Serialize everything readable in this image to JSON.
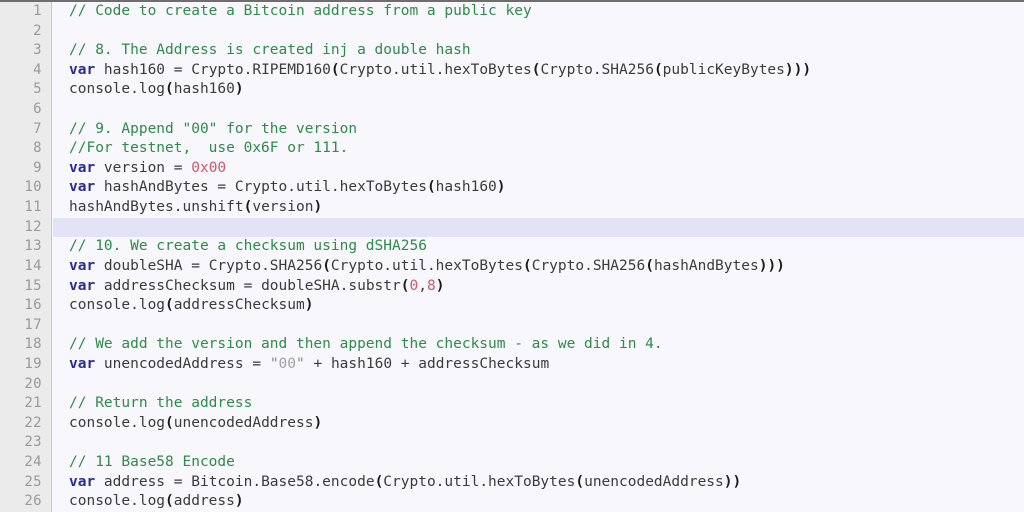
{
  "editor": {
    "name": "code-editor",
    "language": "javascript",
    "first_line": 1,
    "last_line": 26,
    "highlighted_line": 12,
    "colors": {
      "background": "#f7f7fc",
      "gutter_background": "#ebebeb",
      "gutter_divider": "#c8c8c8",
      "line_number": "#9a9a9a",
      "comment": "#2e8b4a",
      "keyword": "#2b2b99",
      "plain_text": "#3b3b3b",
      "bracket": "#1a1a1a",
      "number": "#d1566b",
      "string": "#a0a0a0",
      "highlight_line": "#e3e3f7",
      "top_border": "#6e6e6e"
    }
  },
  "lines": [
    {
      "number": "1",
      "highlight": false,
      "tokens": [
        {
          "type": "com",
          "text": "// Code to create a Bitcoin address from a public key"
        }
      ]
    },
    {
      "number": "2",
      "highlight": false,
      "tokens": []
    },
    {
      "number": "3",
      "highlight": false,
      "tokens": [
        {
          "type": "com",
          "text": "// 8. The Address is created inj a double hash"
        }
      ]
    },
    {
      "number": "4",
      "highlight": false,
      "tokens": [
        {
          "type": "kw",
          "text": "var"
        },
        {
          "type": "txt",
          "text": " hash160 = Crypto.RIPEMD160"
        },
        {
          "type": "par",
          "text": "("
        },
        {
          "type": "txt",
          "text": "Crypto.util.hexToBytes"
        },
        {
          "type": "par",
          "text": "("
        },
        {
          "type": "txt",
          "text": "Crypto.SHA256"
        },
        {
          "type": "par",
          "text": "("
        },
        {
          "type": "txt",
          "text": "publicKeyBytes"
        },
        {
          "type": "par",
          "text": ")))"
        }
      ]
    },
    {
      "number": "5",
      "highlight": false,
      "tokens": [
        {
          "type": "txt",
          "text": "console.log"
        },
        {
          "type": "par",
          "text": "("
        },
        {
          "type": "txt",
          "text": "hash160"
        },
        {
          "type": "par",
          "text": ")"
        }
      ]
    },
    {
      "number": "6",
      "highlight": false,
      "tokens": []
    },
    {
      "number": "7",
      "highlight": false,
      "tokens": [
        {
          "type": "com",
          "text": "// 9. Append \"00\" for the version"
        }
      ]
    },
    {
      "number": "8",
      "highlight": false,
      "tokens": [
        {
          "type": "com",
          "text": "//For testnet,  use 0x6F or 111."
        }
      ]
    },
    {
      "number": "9",
      "highlight": false,
      "tokens": [
        {
          "type": "kw",
          "text": "var"
        },
        {
          "type": "txt",
          "text": " version = "
        },
        {
          "type": "num",
          "text": "0x00"
        }
      ]
    },
    {
      "number": "10",
      "highlight": false,
      "tokens": [
        {
          "type": "kw",
          "text": "var"
        },
        {
          "type": "txt",
          "text": " hashAndBytes = Crypto.util.hexToBytes"
        },
        {
          "type": "par",
          "text": "("
        },
        {
          "type": "txt",
          "text": "hash160"
        },
        {
          "type": "par",
          "text": ")"
        }
      ]
    },
    {
      "number": "11",
      "highlight": false,
      "tokens": [
        {
          "type": "txt",
          "text": "hashAndBytes.unshift"
        },
        {
          "type": "par",
          "text": "("
        },
        {
          "type": "txt",
          "text": "version"
        },
        {
          "type": "par",
          "text": ")"
        }
      ]
    },
    {
      "number": "12",
      "highlight": true,
      "tokens": []
    },
    {
      "number": "13",
      "highlight": false,
      "tokens": [
        {
          "type": "com",
          "text": "// 10. We create a checksum using dSHA256"
        }
      ]
    },
    {
      "number": "14",
      "highlight": false,
      "tokens": [
        {
          "type": "kw",
          "text": "var"
        },
        {
          "type": "txt",
          "text": " doubleSHA = Crypto.SHA256"
        },
        {
          "type": "par",
          "text": "("
        },
        {
          "type": "txt",
          "text": "Crypto.util.hexToBytes"
        },
        {
          "type": "par",
          "text": "("
        },
        {
          "type": "txt",
          "text": "Crypto.SHA256"
        },
        {
          "type": "par",
          "text": "("
        },
        {
          "type": "txt",
          "text": "hashAndBytes"
        },
        {
          "type": "par",
          "text": ")))"
        }
      ]
    },
    {
      "number": "15",
      "highlight": false,
      "tokens": [
        {
          "type": "kw",
          "text": "var"
        },
        {
          "type": "txt",
          "text": " addressChecksum = doubleSHA.substr"
        },
        {
          "type": "par",
          "text": "("
        },
        {
          "type": "num",
          "text": "0"
        },
        {
          "type": "txt",
          "text": ","
        },
        {
          "type": "num",
          "text": "8"
        },
        {
          "type": "par",
          "text": ")"
        }
      ]
    },
    {
      "number": "16",
      "highlight": false,
      "tokens": [
        {
          "type": "txt",
          "text": "console.log"
        },
        {
          "type": "par",
          "text": "("
        },
        {
          "type": "txt",
          "text": "addressChecksum"
        },
        {
          "type": "par",
          "text": ")"
        }
      ]
    },
    {
      "number": "17",
      "highlight": false,
      "tokens": []
    },
    {
      "number": "18",
      "highlight": false,
      "tokens": [
        {
          "type": "com",
          "text": "// We add the version and then append the checksum - as we did in 4."
        }
      ]
    },
    {
      "number": "19",
      "highlight": false,
      "tokens": [
        {
          "type": "kw",
          "text": "var"
        },
        {
          "type": "txt",
          "text": " unencodedAddress = "
        },
        {
          "type": "strq",
          "text": "\""
        },
        {
          "type": "str",
          "text": "00"
        },
        {
          "type": "strq",
          "text": "\""
        },
        {
          "type": "txt",
          "text": " + hash160 + addressChecksum"
        }
      ]
    },
    {
      "number": "20",
      "highlight": false,
      "tokens": []
    },
    {
      "number": "21",
      "highlight": false,
      "tokens": [
        {
          "type": "com",
          "text": "// Return the address"
        }
      ]
    },
    {
      "number": "22",
      "highlight": false,
      "tokens": [
        {
          "type": "txt",
          "text": "console.log"
        },
        {
          "type": "par",
          "text": "("
        },
        {
          "type": "txt",
          "text": "unencodedAddress"
        },
        {
          "type": "par",
          "text": ")"
        }
      ]
    },
    {
      "number": "23",
      "highlight": false,
      "tokens": []
    },
    {
      "number": "24",
      "highlight": false,
      "tokens": [
        {
          "type": "com",
          "text": "// 11 Base58 Encode"
        }
      ]
    },
    {
      "number": "25",
      "highlight": false,
      "tokens": [
        {
          "type": "kw",
          "text": "var"
        },
        {
          "type": "txt",
          "text": " address = Bitcoin.Base58.encode"
        },
        {
          "type": "par",
          "text": "("
        },
        {
          "type": "txt",
          "text": "Crypto.util.hexToBytes"
        },
        {
          "type": "par",
          "text": "("
        },
        {
          "type": "txt",
          "text": "unencodedAddress"
        },
        {
          "type": "par",
          "text": "))"
        }
      ]
    },
    {
      "number": "26",
      "highlight": false,
      "tokens": [
        {
          "type": "txt",
          "text": "console.log"
        },
        {
          "type": "par",
          "text": "("
        },
        {
          "type": "txt",
          "text": "address"
        },
        {
          "type": "par",
          "text": ")"
        }
      ]
    }
  ]
}
